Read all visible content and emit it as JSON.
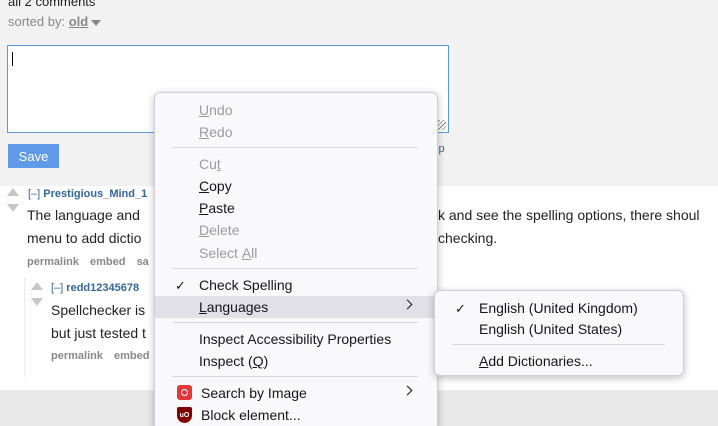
{
  "page": {
    "comments_count": "all 2 comments",
    "sorted_label": "sorted by:",
    "sorted_value": "old",
    "save_label": "Save",
    "help_link": "lp"
  },
  "comments": [
    {
      "collapse": "[–]",
      "author": "Prestigious_Mind_1",
      "body_line1": "The language and",
      "body_line1_right": "k and see the spelling options, there shoul",
      "body_line2": "menu to add dictio",
      "body_line2_right": "checking.",
      "actions": [
        "permalink",
        "embed",
        "sa"
      ]
    },
    {
      "collapse": "[–]",
      "author": "redd12345678",
      "body_line1": "Spellchecker is",
      "body_line2": "but just tested t",
      "actions": [
        "permalink",
        "embed"
      ]
    }
  ],
  "context_menu": {
    "items": [
      {
        "label": "Undo",
        "mnemonic": "U",
        "rest": "ndo",
        "disabled": true
      },
      {
        "label": "Redo",
        "mnemonic": "R",
        "rest": "edo",
        "disabled": true
      },
      {
        "label": "Cut",
        "pre": "Cu",
        "mnemonic": "t",
        "disabled": true
      },
      {
        "label": "Copy",
        "mnemonic": "C",
        "rest": "opy",
        "disabled": false
      },
      {
        "label": "Paste",
        "mnemonic": "P",
        "rest": "aste",
        "disabled": false
      },
      {
        "label": "Delete",
        "mnemonic": "D",
        "rest": "elete",
        "disabled": true
      },
      {
        "label": "Select All",
        "pre": "Select ",
        "mnemonic": "A",
        "rest": "ll",
        "disabled": true
      },
      {
        "label": "Check Spelling",
        "checked": true
      },
      {
        "label": "Languages",
        "mnemonic": "L",
        "rest": "anguages",
        "submenu": true
      },
      {
        "label": "Inspect Accessibility Properties"
      },
      {
        "label": "Inspect (Q)",
        "pre": "Inspect (",
        "mnemonic": "Q",
        "rest": ")"
      },
      {
        "label": "Search by Image",
        "submenu": true
      },
      {
        "label": "Block element..."
      }
    ]
  },
  "languages_menu": {
    "items": [
      {
        "label": "English (United Kingdom)",
        "checked": true
      },
      {
        "label": "English (United States)"
      },
      {
        "label": "Add Dictionaries...",
        "mnemonic": "A",
        "rest": "dd Dictionaries..."
      }
    ]
  }
}
